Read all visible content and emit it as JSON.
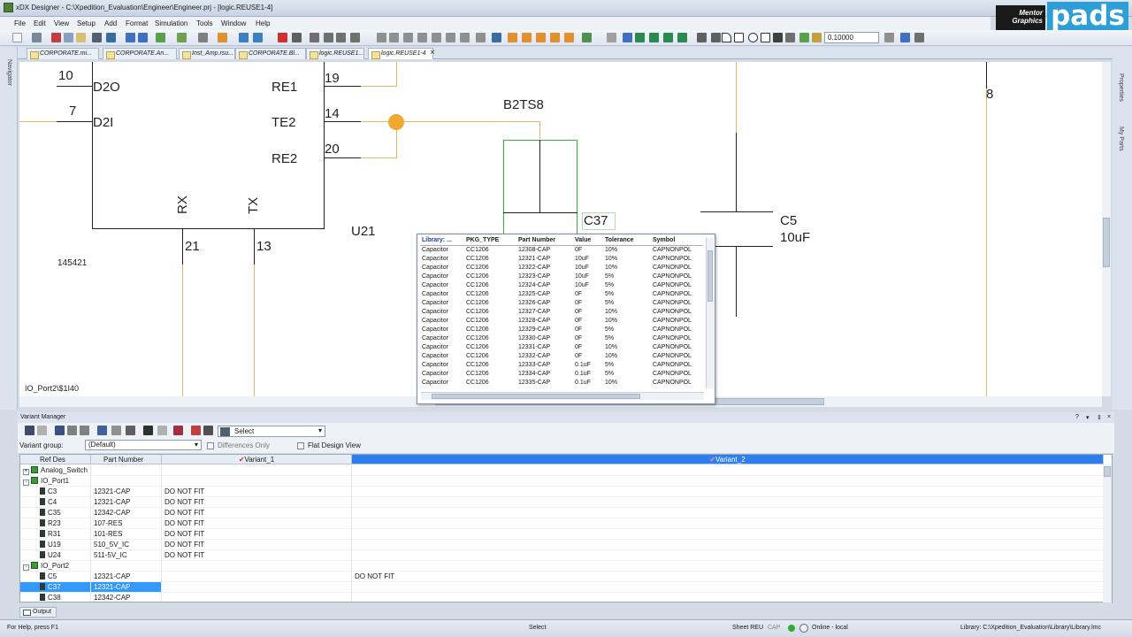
{
  "window": {
    "title": "xDX Designer - C:\\Xpedition_Evaluation\\Engineer\\Engineer.prj - [logic.REUSE1-4]"
  },
  "brand": {
    "vendor": "Mentor Graphics",
    "product": "pads"
  },
  "menu": [
    "File",
    "Edit",
    "View",
    "Setup",
    "Add",
    "Format",
    "Simulation",
    "Tools",
    "Window",
    "Help"
  ],
  "toolbar": {
    "zoom": "0.10000"
  },
  "tabs": [
    "CORPORATE.mi...",
    "CORPORATE.An...",
    "Inst_Amp.rsu...",
    "CORPORATE.Bl...",
    "logic.REUSE1...",
    "logic.REUSE1-4"
  ],
  "tab_close": "×",
  "left_panel": "Navigator",
  "right_panel": [
    "Properties",
    "My Parts"
  ],
  "schematic": {
    "pins_left": [
      {
        "num": "10",
        "name": "D2O"
      },
      {
        "num": "7",
        "name": "D2I"
      }
    ],
    "pins_right": [
      {
        "num": "19",
        "name": "RE1"
      },
      {
        "num": "14",
        "name": "TE2"
      },
      {
        "num": "20",
        "name": "RE2"
      }
    ],
    "pins_bottom": [
      {
        "num": "21",
        "name": "RX"
      },
      {
        "num": "13",
        "name": "TX"
      }
    ],
    "part_number": "145421",
    "refdes_u": "U21",
    "b2ts8": "B2TS8",
    "c37": "C37",
    "c5_ref": "C5",
    "c5_value": "10uF",
    "net_8": "8",
    "sheet_label": "IO_Port2\\$1I40"
  },
  "popup": {
    "columns": [
      "Library: ...",
      "PKG_TYPE",
      "Part Number",
      "Value",
      "Tolerance",
      "Symbol"
    ],
    "rows": [
      [
        "Capacitor",
        "CC1206",
        "12308-CAP",
        "0F",
        "10%",
        "CAPNONPOL"
      ],
      [
        "Capacitor",
        "CC1206",
        "12321-CAP",
        "10uF",
        "10%",
        "CAPNONPOL"
      ],
      [
        "Capacitor",
        "CC1206",
        "12322-CAP",
        "10uF",
        "10%",
        "CAPNONPOL"
      ],
      [
        "Capacitor",
        "CC1206",
        "12323-CAP",
        "10uF",
        "5%",
        "CAPNONPOL"
      ],
      [
        "Capacitor",
        "CC1206",
        "12324-CAP",
        "10uF",
        "5%",
        "CAPNONPOL"
      ],
      [
        "Capacitor",
        "CC1206",
        "12325-CAP",
        "0F",
        "5%",
        "CAPNONPOL"
      ],
      [
        "Capacitor",
        "CC1206",
        "12326-CAP",
        "0F",
        "5%",
        "CAPNONPOL"
      ],
      [
        "Capacitor",
        "CC1206",
        "12327-CAP",
        "0F",
        "10%",
        "CAPNONPOL"
      ],
      [
        "Capacitor",
        "CC1206",
        "12328-CAP",
        "0F",
        "10%",
        "CAPNONPOL"
      ],
      [
        "Capacitor",
        "CC1206",
        "12329-CAP",
        "0F",
        "5%",
        "CAPNONPOL"
      ],
      [
        "Capacitor",
        "CC1206",
        "12330-CAP",
        "0F",
        "5%",
        "CAPNONPOL"
      ],
      [
        "Capacitor",
        "CC1206",
        "12331-CAP",
        "0F",
        "10%",
        "CAPNONPOL"
      ],
      [
        "Capacitor",
        "CC1206",
        "12332-CAP",
        "0F",
        "10%",
        "CAPNONPOL"
      ],
      [
        "Capacitor",
        "CC1206",
        "12333-CAP",
        "0.1uF",
        "5%",
        "CAPNONPOL"
      ],
      [
        "Capacitor",
        "CC1206",
        "12334-CAP",
        "0.1uF",
        "5%",
        "CAPNONPOL"
      ],
      [
        "Capacitor",
        "CC1206",
        "12335-CAP",
        "0.1uF",
        "10%",
        "CAPNONPOL"
      ]
    ]
  },
  "variant_manager": {
    "title": "Variant Manager",
    "header_buttons": [
      "?",
      "▾",
      "⇕",
      "×"
    ],
    "select_label": "Select",
    "group_label": "Variant group:",
    "group_value": "(Default)",
    "differences_only": "Differences Only",
    "flat_design_view": "Flat Design View",
    "columns": [
      "Ref Des",
      "Part Number",
      "Variant_1",
      "Variant_2"
    ],
    "tree": [
      {
        "kind": "group",
        "name": "Analog_Switch",
        "toggle": "+"
      },
      {
        "kind": "group",
        "name": "IO_Port1",
        "toggle": "-"
      },
      {
        "kind": "part",
        "ref": "C3",
        "pn": "12321-CAP",
        "v1": "DO NOT FIT",
        "v2": ""
      },
      {
        "kind": "part",
        "ref": "C4",
        "pn": "12321-CAP",
        "v1": "DO NOT FIT",
        "v2": ""
      },
      {
        "kind": "part",
        "ref": "C35",
        "pn": "12342-CAP",
        "v1": "DO NOT FIT",
        "v2": ""
      },
      {
        "kind": "part",
        "ref": "R23",
        "pn": "107-RES",
        "v1": "DO NOT FIT",
        "v2": ""
      },
      {
        "kind": "part",
        "ref": "R31",
        "pn": "101-RES",
        "v1": "DO NOT FIT",
        "v2": ""
      },
      {
        "kind": "part",
        "ref": "U19",
        "pn": "510_5V_IC",
        "v1": "DO NOT FIT",
        "v2": ""
      },
      {
        "kind": "part",
        "ref": "U24",
        "pn": "511-5V_IC",
        "v1": "DO NOT FIT",
        "v2": ""
      },
      {
        "kind": "group",
        "name": "IO_Port2",
        "toggle": "-"
      },
      {
        "kind": "part",
        "ref": "C5",
        "pn": "12321-CAP",
        "v1": "",
        "v2": "DO NOT FIT"
      },
      {
        "kind": "part",
        "ref": "C37",
        "pn": "12321-CAP",
        "v1": "",
        "v2": "",
        "selected": true
      },
      {
        "kind": "part",
        "ref": "C38",
        "pn": "12342-CAP",
        "v1": "",
        "v2": ""
      }
    ]
  },
  "output_tab": "Output",
  "status": {
    "help": "For Help, press F1",
    "mode": "Select",
    "sheet": "Sheet REU",
    "cap": "CAP",
    "online": "Online - local",
    "library": "Library: C:\\Xpedition_Evaluation\\Library\\Library.lmc"
  },
  "colors": {
    "accent": "#3399ff",
    "wire": "#e6b46a",
    "net_dot": "#f0a830",
    "header_blue": "#2d7ff0",
    "pads_blue": "#2d9fd6"
  }
}
